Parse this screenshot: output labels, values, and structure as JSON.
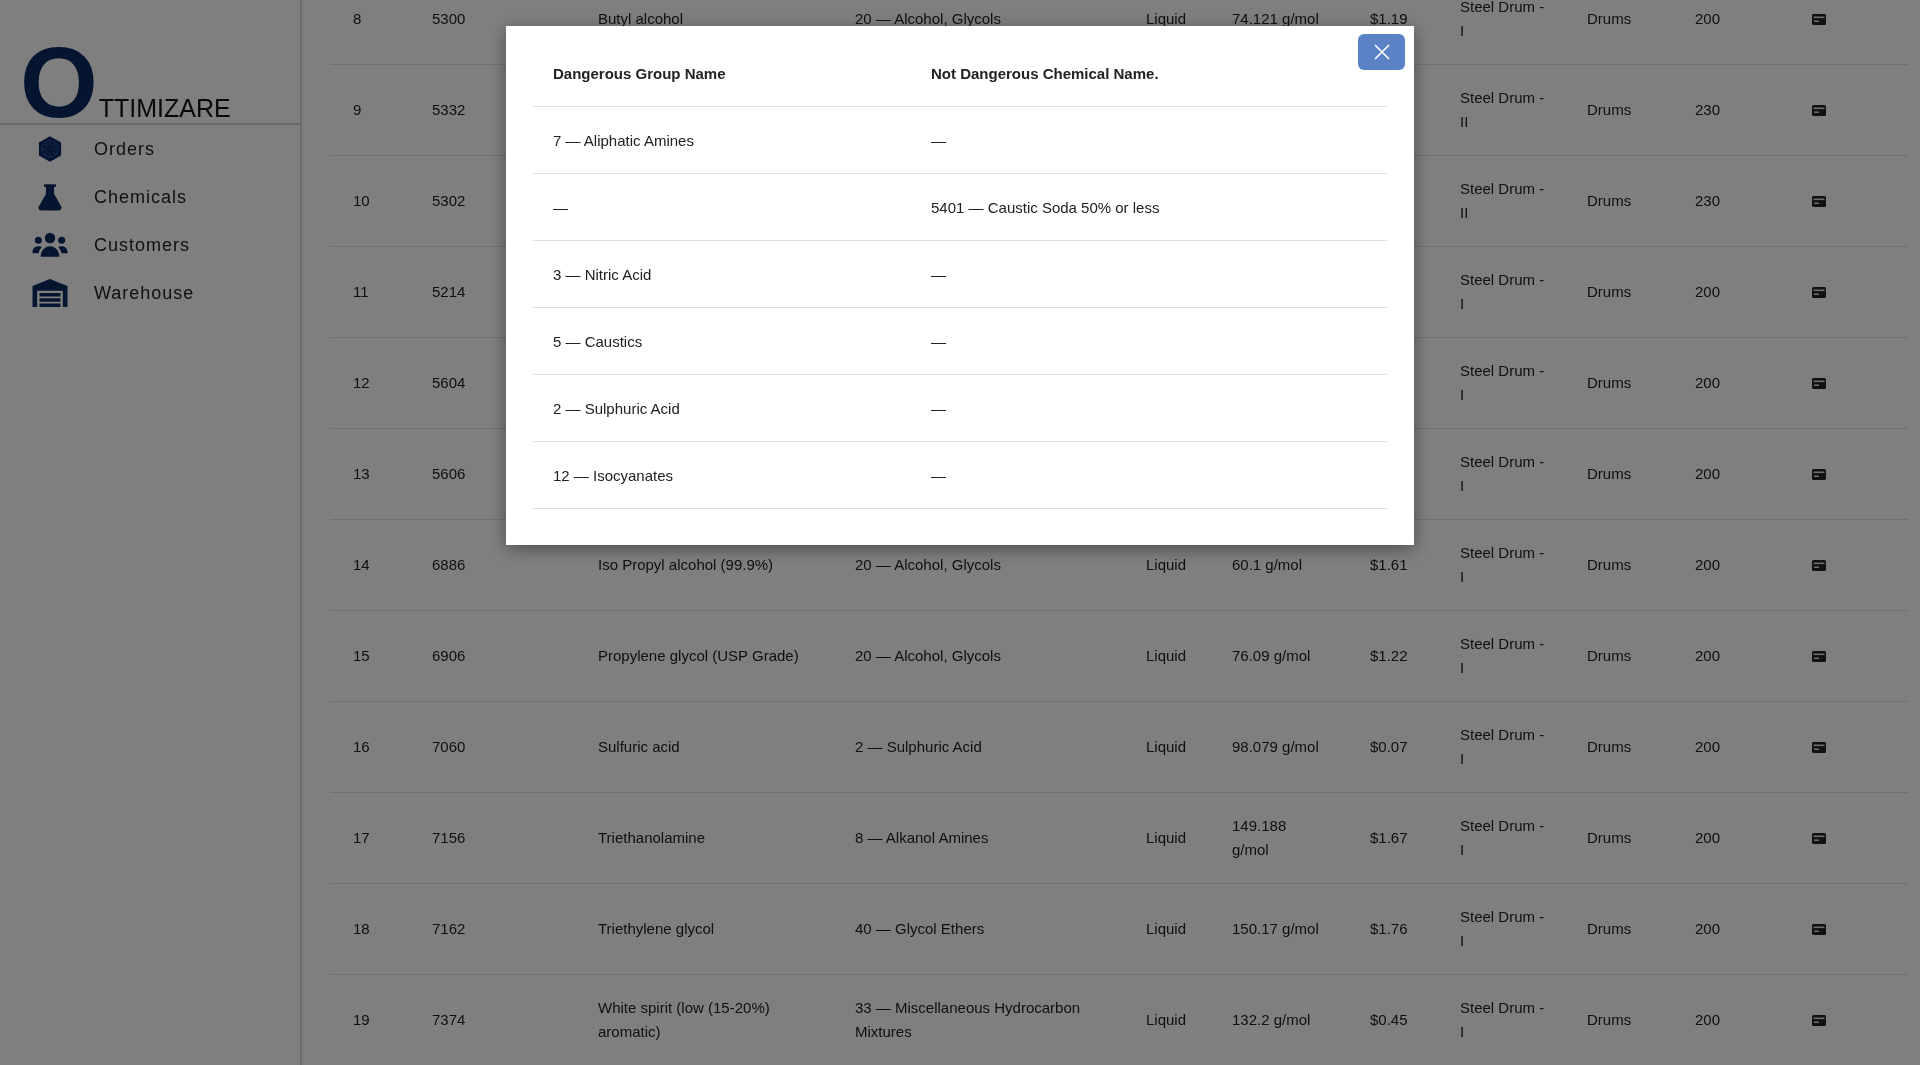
{
  "sidebar": {
    "logo": {
      "initial": "O",
      "rest": "TTIMIZARE"
    },
    "items": [
      {
        "label": "Orders",
        "kind": "orders"
      },
      {
        "label": "Chemicals",
        "kind": "chemicals"
      },
      {
        "label": "Customers",
        "kind": "customers"
      },
      {
        "label": "Warehouse",
        "kind": "warehouse"
      }
    ]
  },
  "table": {
    "rows": [
      {
        "number": "8",
        "code": "5300",
        "name": "Butyl alcohol",
        "group": "20 — Alcohol, Glycols",
        "state": "Liquid",
        "molar_mass": "74.121 g/mol",
        "price": "$1.19",
        "package": "Steel Drum - I",
        "type": "Drums",
        "quantity": "200"
      },
      {
        "number": "9",
        "code": "5332",
        "package": "Steel Drum - II",
        "type": "Drums",
        "quantity": "230"
      },
      {
        "number": "10",
        "code": "5302",
        "package": "Steel Drum - II",
        "type": "Drums",
        "quantity": "230"
      },
      {
        "number": "11",
        "code": "5214",
        "package": "Steel Drum - I",
        "type": "Drums",
        "quantity": "200"
      },
      {
        "number": "12",
        "code": "5604",
        "package": "Steel Drum - I",
        "type": "Drums",
        "quantity": "200"
      },
      {
        "number": "13",
        "code": "5606",
        "package": "Steel Drum - I",
        "type": "Drums",
        "quantity": "200"
      },
      {
        "number": "14",
        "code": "6886",
        "name": "Iso Propyl alcohol (99.9%)",
        "group": "20 — Alcohol, Glycols",
        "state": "Liquid",
        "molar_mass": "60.1 g/mol",
        "price": "$1.61",
        "package": "Steel Drum - I",
        "type": "Drums",
        "quantity": "200"
      },
      {
        "number": "15",
        "code": "6906",
        "name": "Propylene glycol (USP Grade)",
        "group": "20 — Alcohol, Glycols",
        "state": "Liquid",
        "molar_mass": "76.09 g/mol",
        "price": "$1.22",
        "package": "Steel Drum - I",
        "type": "Drums",
        "quantity": "200"
      },
      {
        "number": "16",
        "code": "7060",
        "name": "Sulfuric acid",
        "group": "2 — Sulphuric Acid",
        "state": "Liquid",
        "molar_mass": "98.079 g/mol",
        "price": "$0.07",
        "package": "Steel Drum - I",
        "type": "Drums",
        "quantity": "200"
      },
      {
        "number": "17",
        "code": "7156",
        "name": "Triethanolamine",
        "group": "8 — Alkanol Amines",
        "state": "Liquid",
        "molar_mass": "149.188 g/mol",
        "price": "$1.67",
        "package": "Steel Drum - I",
        "type": "Drums",
        "quantity": "200"
      },
      {
        "number": "18",
        "code": "7162",
        "name": "Triethylene glycol",
        "group": "40 — Glycol Ethers",
        "state": "Liquid",
        "molar_mass": "150.17 g/mol",
        "price": "$1.76",
        "package": "Steel Drum - I",
        "type": "Drums",
        "quantity": "200"
      },
      {
        "number": "19",
        "code": "7374",
        "name": "White spirit (low (15-20%) aromatic)",
        "group": "33 — Miscellaneous Hydrocarbon Mixtures",
        "state": "Liquid",
        "molar_mass": "132.2 g/mol",
        "price": "$0.45",
        "package": "Steel Drum - I",
        "type": "Drums",
        "quantity": "200"
      }
    ]
  },
  "modal": {
    "columns": [
      "Dangerous Group Name",
      "Not Dangerous Chemical Name."
    ],
    "rows": [
      {
        "dangerous_group": "7 — Aliphatic Amines",
        "not_dangerous_chemical": "—"
      },
      {
        "dangerous_group": "—",
        "not_dangerous_chemical": "5401 — Caustic Soda 50% or less"
      },
      {
        "dangerous_group": "3 — Nitric Acid",
        "not_dangerous_chemical": "—"
      },
      {
        "dangerous_group": "5 — Caustics",
        "not_dangerous_chemical": "—"
      },
      {
        "dangerous_group": "2 — Sulphuric Acid",
        "not_dangerous_chemical": "—"
      },
      {
        "dangerous_group": "12 — Isocyanates",
        "not_dangerous_chemical": "—"
      }
    ]
  }
}
